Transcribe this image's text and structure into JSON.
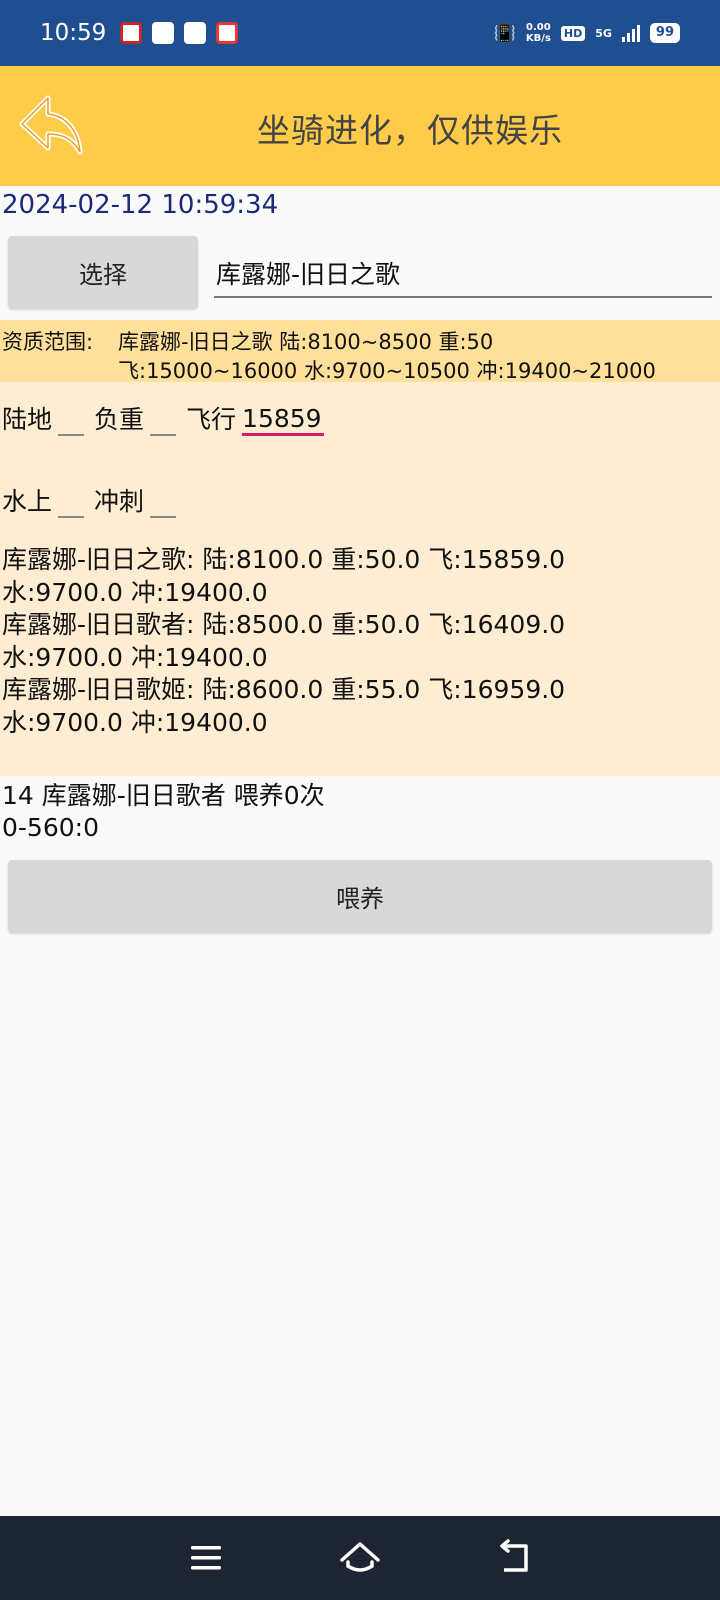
{
  "status": {
    "time": "10:59",
    "net_speed_value": "0.00",
    "net_speed_unit": "KB/s",
    "hd": "HD",
    "network": "5G",
    "battery": "99"
  },
  "header": {
    "title": "坐骑进化，仅供娱乐"
  },
  "timestamp": "2024-02-12 10:59:34",
  "selector": {
    "button_label": "选择",
    "selected_mount": "库露娜-旧日之歌"
  },
  "range": {
    "label": "资质范围:",
    "line1": "库露娜-旧日之歌 陆:8100~8500 重:50",
    "line2": "飞:15000~16000 水:9700~10500 冲:19400~21000"
  },
  "fields": {
    "land_label": "陆地",
    "weight_label": "负重",
    "fly_label": "飞行",
    "fly_value": "15859",
    "water_label": "水上",
    "sprint_label": "冲刺"
  },
  "results_text": "库露娜-旧日之歌: 陆:8100.0 重:50.0 飞:15859.0\n水:9700.0 冲:19400.0\n库露娜-旧日歌者: 陆:8500.0 重:50.0 飞:16409.0\n水:9700.0 冲:19400.0\n库露娜-旧日歌姬: 陆:8600.0 重:55.0 飞:16959.0\n水:9700.0 冲:19400.0",
  "feed_info": {
    "line1": "14 库露娜-旧日歌者 喂养0次",
    "line2": "0-560:0"
  },
  "feed_button_label": "喂养",
  "colors": {
    "status_bar": "#1f4e91",
    "title_bar": "#ffcc4a",
    "range_bg": "#ffe09b",
    "panel_bg": "#ffedd3",
    "accent_underline": "#d81b60"
  }
}
